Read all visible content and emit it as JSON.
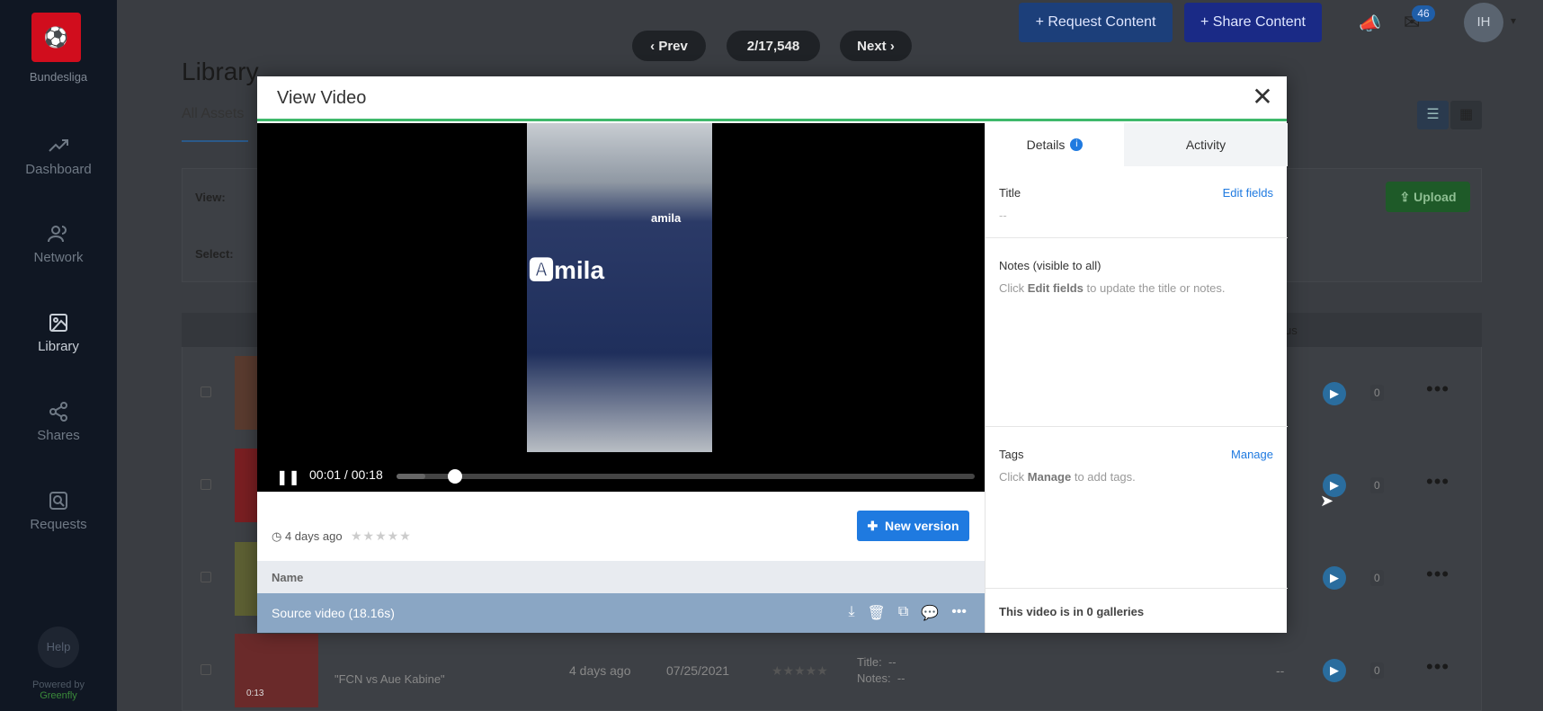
{
  "app": {
    "brand_name": "Bundesliga",
    "help_label": "Help",
    "powered_by": "Powered by",
    "powered_name": "Greenfly"
  },
  "sidebar": {
    "items": [
      {
        "label": "Dashboard",
        "icon": "trending-up-icon"
      },
      {
        "label": "Network",
        "icon": "users-icon"
      },
      {
        "label": "Library",
        "icon": "image-icon"
      },
      {
        "label": "Shares",
        "icon": "share-icon"
      },
      {
        "label": "Requests",
        "icon": "search-icon"
      }
    ]
  },
  "header": {
    "request_content": "+ Request Content",
    "share_content": "+ Share Content",
    "notifications_count": "46",
    "avatar_initials": "IH"
  },
  "pager": {
    "prev": "Prev",
    "position": "2/17,548",
    "next": "Next"
  },
  "library": {
    "title": "Library",
    "tab_all": "All Assets",
    "view_label": "View:",
    "select_label": "Select:",
    "upload": "Upload",
    "column_status_fragment": "us"
  },
  "rows": [
    {
      "title": "\"FCN vs Aue Kabine\"",
      "age": "4 days ago",
      "date": "07/25/2021",
      "title_label": "Title:",
      "title_value": "--",
      "notes_label": "Notes:",
      "notes_value": "--",
      "status": "--",
      "count": "0",
      "thumb_time": "0:13"
    }
  ],
  "modal": {
    "title": "View Video",
    "player": {
      "time": "00:01 / 00:18",
      "progress": 0.05
    },
    "uploaded": "4 days ago",
    "rating": 0,
    "new_version": "New version",
    "table_header": "Name",
    "source_row": "Source video (18.16s)",
    "details": {
      "tab_details": "Details",
      "tab_activity": "Activity",
      "title_label": "Title",
      "edit_fields": "Edit fields",
      "title_value": "--",
      "notes_label": "Notes (visible to all)",
      "notes_hint_pre": "Click",
      "notes_hint_bold": "Edit fields",
      "notes_hint_post": "to update the title or notes.",
      "tags_label": "Tags",
      "manage": "Manage",
      "tags_hint_pre": "Click",
      "tags_hint_bold": "Manage",
      "tags_hint_post": "to add tags.",
      "galleries": "This video is in 0 galleries"
    }
  },
  "colors": {
    "accent_blue": "#1f7ae0",
    "green": "#3fb96b",
    "brand_red": "#d10d1d",
    "sidebar_bg": "#101723"
  }
}
